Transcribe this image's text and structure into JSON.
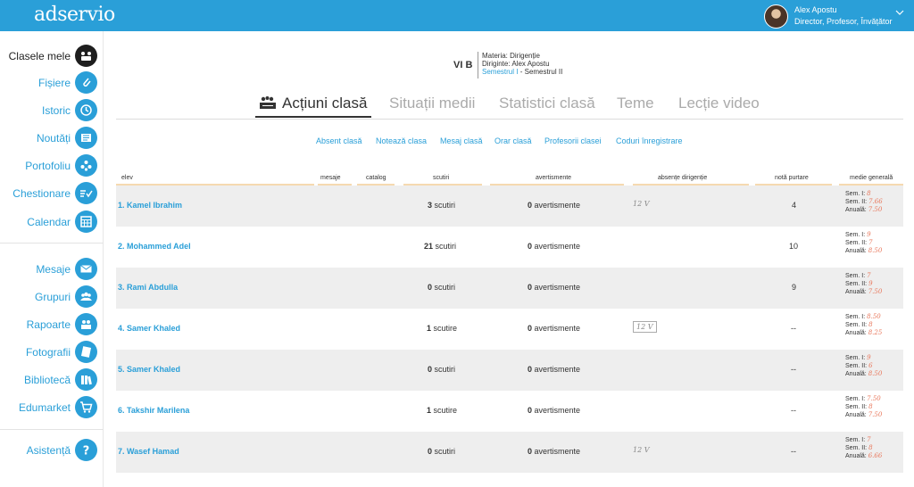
{
  "app": {
    "logo": "adservio",
    "user_name": "Alex Apostu",
    "user_role": "Director, Profesor, Învățător"
  },
  "sidebar": {
    "items": [
      {
        "label": "Clasele mele",
        "icon": "class-group-icon",
        "active": true
      },
      {
        "label": "Fișiere",
        "icon": "paperclip-icon"
      },
      {
        "label": "Istoric",
        "icon": "history-icon"
      },
      {
        "label": "Noutăți",
        "icon": "news-icon"
      },
      {
        "label": "Portofoliu",
        "icon": "portfolio-icon"
      },
      {
        "label": "Chestionare",
        "icon": "questionnaire-icon"
      },
      {
        "label": "Calendar",
        "icon": "calendar-icon"
      },
      {
        "label": "Mesaje",
        "icon": "mail-icon"
      },
      {
        "label": "Grupuri",
        "icon": "groups-icon"
      },
      {
        "label": "Rapoarte",
        "icon": "reports-icon"
      },
      {
        "label": "Fotografii",
        "icon": "photos-icon"
      },
      {
        "label": "Bibliotecă",
        "icon": "library-icon"
      },
      {
        "label": "Edumarket",
        "icon": "cart-icon"
      },
      {
        "label": "Asistență",
        "icon": "help-icon"
      }
    ]
  },
  "class_header": {
    "name": "VI B",
    "subject": "Materia: Dirigenție",
    "head_teacher": "Diriginte: Alex Apostu",
    "semester_1": "Semestrul I",
    "semester_sep": "-",
    "semester_2": "Semestrul II"
  },
  "tabs": [
    {
      "label": "Acțiuni clasă",
      "active": true
    },
    {
      "label": "Situații medii"
    },
    {
      "label": "Statistici clasă"
    },
    {
      "label": "Teme"
    },
    {
      "label": "Lecție video"
    }
  ],
  "actions": [
    "Absent clasă",
    "Notează clasa",
    "Mesaj clasă",
    "Orar clasă",
    "Profesorii clasei",
    "Coduri înregistrare"
  ],
  "table": {
    "headers": {
      "elev": "elev",
      "mesaje": "mesaje",
      "catalog": "catalog",
      "scutiri": "scutiri",
      "avertismente": "avertismente",
      "absente": "absențe dirigenție",
      "purtare": "notă purtare",
      "medie": "medie generală"
    },
    "labels": {
      "sem1": "Sem. I:",
      "sem2": "Sem. II:",
      "anuala": "Anuală:"
    },
    "rows": [
      {
        "name": "1. Kamel Ibrahim",
        "scutiri_count": "3",
        "scutiri_label": "scutiri",
        "avert_count": "0",
        "avert_label": "avertismente",
        "absente": "12 V",
        "absente_boxed": false,
        "purtare": "4",
        "sem1": "8",
        "sem2": "7.66",
        "anuala": "7.50"
      },
      {
        "name": "2. Mohammed Adel",
        "scutiri_count": "21",
        "scutiri_label": "scutiri",
        "avert_count": "0",
        "avert_label": "avertismente",
        "absente": "",
        "absente_boxed": false,
        "purtare": "10",
        "sem1": "9",
        "sem2": "7",
        "anuala": "8.50"
      },
      {
        "name": "3. Rami Abdulla",
        "scutiri_count": "0",
        "scutiri_label": "scutiri",
        "avert_count": "0",
        "avert_label": "avertismente",
        "absente": "",
        "absente_boxed": false,
        "purtare": "9",
        "sem1": "7",
        "sem2": "9",
        "anuala": "7.50"
      },
      {
        "name": "4. Samer Khaled",
        "scutiri_count": "1",
        "scutiri_label": "scutire",
        "avert_count": "0",
        "avert_label": "avertismente",
        "absente": "12 V",
        "absente_boxed": true,
        "purtare": "--",
        "sem1": "8.50",
        "sem2": "8",
        "anuala": "8.25"
      },
      {
        "name": "5. Samer Khaled",
        "scutiri_count": "0",
        "scutiri_label": "scutiri",
        "avert_count": "0",
        "avert_label": "avertismente",
        "absente": "",
        "absente_boxed": false,
        "purtare": "--",
        "sem1": "9",
        "sem2": "6",
        "anuala": "8.50"
      },
      {
        "name": "6. Takshir Marilena",
        "scutiri_count": "1",
        "scutiri_label": "scutire",
        "avert_count": "0",
        "avert_label": "avertismente",
        "absente": "",
        "absente_boxed": false,
        "purtare": "--",
        "sem1": "7.50",
        "sem2": "8",
        "anuala": "7.50"
      },
      {
        "name": "7. Wasef Hamad",
        "scutiri_count": "0",
        "scutiri_label": "scutiri",
        "avert_count": "0",
        "avert_label": "avertismente",
        "absente": "12 V",
        "absente_boxed": false,
        "purtare": "--",
        "sem1": "7",
        "sem2": "8",
        "anuala": "6.66"
      }
    ]
  }
}
